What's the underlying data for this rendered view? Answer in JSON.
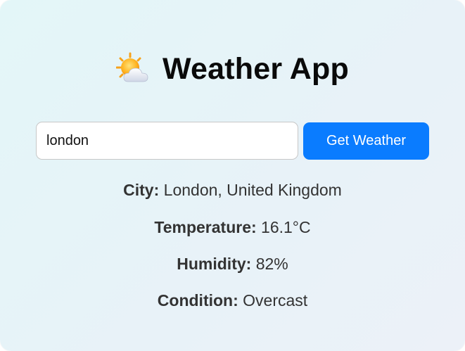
{
  "app": {
    "title": "Weather App",
    "icon": "sun-behind-cloud-icon"
  },
  "search": {
    "value": "london",
    "button_label": "Get Weather"
  },
  "results": {
    "city_label": "City:",
    "city_value": "London, United Kingdom",
    "temperature_label": "Temperature:",
    "temperature_value": "16.1°C",
    "humidity_label": "Humidity:",
    "humidity_value": "82%",
    "condition_label": "Condition:",
    "condition_value": "Overcast"
  },
  "colors": {
    "button": "#0a7cff",
    "text": "#333333",
    "title": "#0a0a0a"
  }
}
